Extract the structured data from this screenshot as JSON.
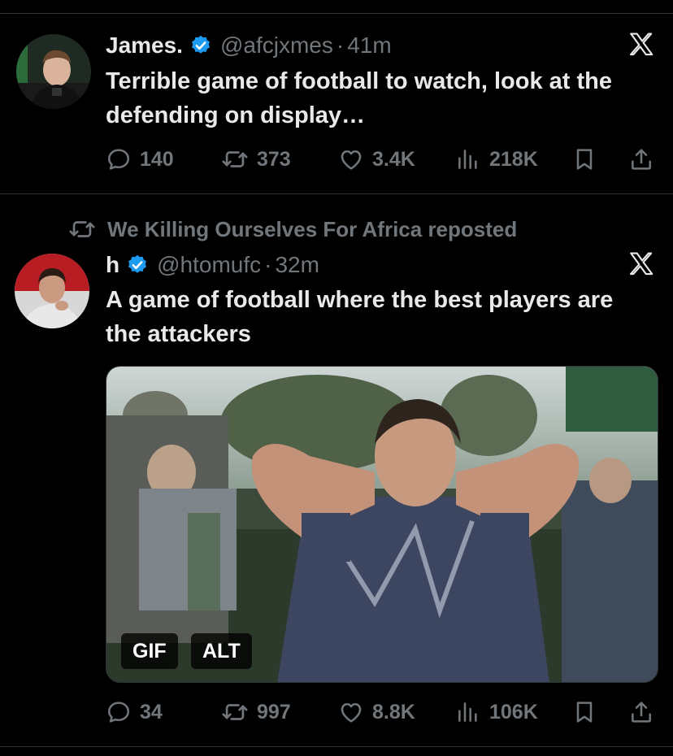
{
  "tweets": [
    {
      "name": "James.",
      "handle": "@afcjxmes",
      "separator": "·",
      "time": "41m",
      "text": "Terrible game of football to watch, look at the defending on display…",
      "replies": "140",
      "reposts": "373",
      "likes": "3.4K",
      "views": "218K"
    },
    {
      "repost_banner": "We Killing Ourselves For Africa reposted",
      "name": "h",
      "handle": "@htomufc",
      "separator": "·",
      "time": "32m",
      "text": "A game of football where the best players are the attackers",
      "media": {
        "gif_label": "GIF",
        "alt_label": "ALT"
      },
      "replies": "34",
      "reposts": "997",
      "likes": "8.8K",
      "views": "106K"
    }
  ],
  "colors": {
    "background": "#000000",
    "text": "#e7e9ea",
    "muted": "#71767b",
    "verified": "#1d9bf0",
    "divider": "#2f3336"
  },
  "icons": [
    "reply-icon",
    "repost-icon",
    "like-icon",
    "views-icon",
    "bookmark-icon",
    "share-icon",
    "verified-badge-icon",
    "x-logo-icon"
  ]
}
